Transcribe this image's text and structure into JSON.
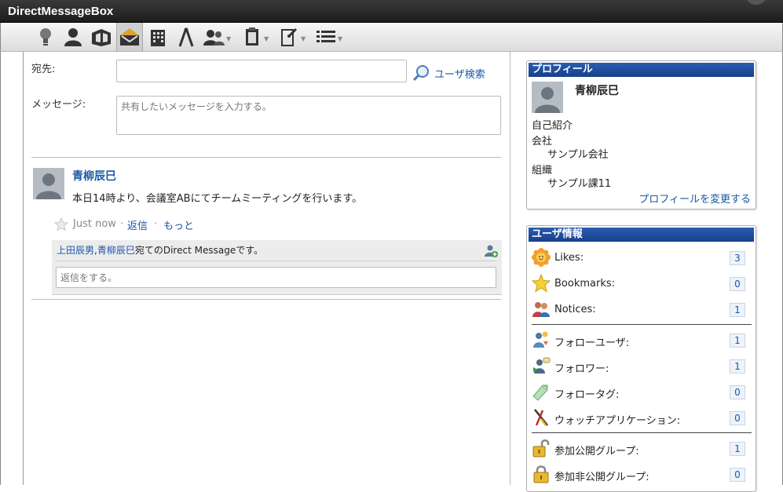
{
  "window": {
    "title": "DirectMessageBox"
  },
  "toolbar": {
    "icons": [
      "bulb-icon",
      "person-icon",
      "open-box-icon",
      "envelope-icon",
      "building-icon",
      "compass-icon",
      "group-icon",
      "clipboard-icon",
      "document-pin-icon",
      "list-icon"
    ]
  },
  "compose": {
    "to_label": "宛先:",
    "to_value": "",
    "user_search_label": "ユーザ検索",
    "message_label": "メッセージ:",
    "message_placeholder": "共有したいメッセージを入力する。"
  },
  "post": {
    "author": "青柳辰巳",
    "body": "本日14時より、会議室ABにてチームミーティングを行います。",
    "timestamp": "Just now",
    "sep1": "·",
    "reply_link": "返信",
    "sep2": "·",
    "more_link": "もっと",
    "recipient1": "上田辰男",
    "recipient_sep": ",",
    "recipient2": "青柳辰巳",
    "recipient_suffix": "宛てのDirect Messageです。",
    "reply_placeholder": "返信をする。"
  },
  "profile": {
    "header": "プロフィール",
    "name": "青柳辰巳",
    "intro_label": "自己紹介",
    "company_label": "会社",
    "company_value": "サンプル会社",
    "org_label": "組織",
    "org_value": "サンプル課11",
    "edit_link": "プロフィールを変更する"
  },
  "user_info": {
    "header": "ユーザ情報",
    "rows": [
      {
        "label": "Likes:",
        "count": "3",
        "icon": "flower-icon"
      },
      {
        "label": "Bookmarks:",
        "count": "0",
        "icon": "star-icon"
      },
      {
        "label": "Notices:",
        "count": "1",
        "icon": "people-icon"
      },
      {
        "label": "フォローユーザ:",
        "count": "1",
        "icon": "follow-user-icon"
      },
      {
        "label": "フォロワー:",
        "count": "1",
        "icon": "follower-icon"
      },
      {
        "label": "フォロータグ:",
        "count": "0",
        "icon": "tag-icon"
      },
      {
        "label": "ウォッチアプリケーション:",
        "count": "0",
        "icon": "tools-icon"
      },
      {
        "label": "参加公開グループ:",
        "count": "1",
        "icon": "unlocked-icon"
      },
      {
        "label": "参加非公開グループ:",
        "count": "0",
        "icon": "locked-icon"
      }
    ]
  },
  "colors": {
    "link": "#1a56a8",
    "header_blue": "#1a3f8a",
    "titlebar": "#1c1c1c"
  }
}
